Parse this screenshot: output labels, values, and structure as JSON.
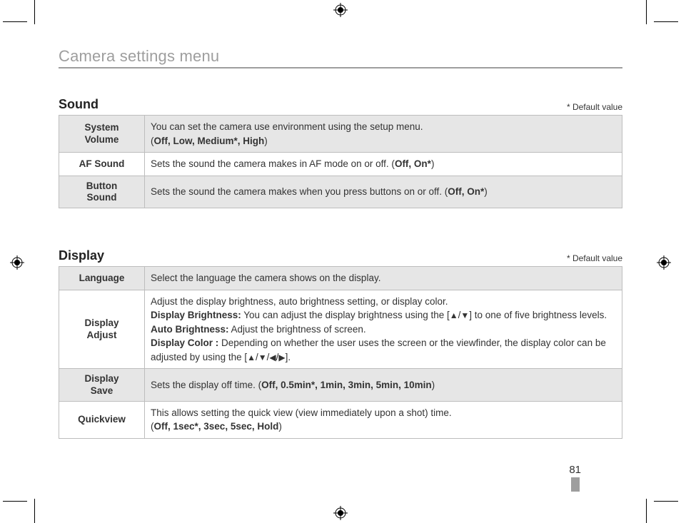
{
  "title": "Camera settings menu",
  "default_note": "* Default value",
  "arrows": {
    "up": "▲",
    "down": "▼",
    "left": "◀",
    "right": "▶",
    "slash": "/"
  },
  "sound": {
    "heading": "Sound",
    "rows": [
      {
        "label_line1": "System",
        "label_line2": "Volume",
        "desc": "You can set the camera use environment using the setup menu.",
        "opts_prefix": "(",
        "opts": "Off, Low, Medium*, High",
        "opts_suffix": ")"
      },
      {
        "label": "AF Sound",
        "desc": "Sets the sound the camera makes in AF mode on or off. (",
        "opts": "Off, On*",
        "opts_suffix": ")"
      },
      {
        "label_line1": "Button",
        "label_line2": "Sound",
        "desc": "Sets the sound the camera makes when you press buttons on or off. (",
        "opts": "Off, On*",
        "opts_suffix": ")"
      }
    ]
  },
  "display": {
    "heading": "Display",
    "rows": [
      {
        "label": "Language",
        "desc": "Select the language the camera shows on the display."
      },
      {
        "label_line1": "Display",
        "label_line2": "Adjust",
        "intro": "Adjust the display brightness, auto brightness setting, or display color.",
        "db_label": "Display Brightness:",
        "db_text_a": " You can adjust the display brightness using the [",
        "db_text_b": "] to one of five brightness levels.",
        "ab_label": "Auto Brightness:",
        "ab_text": " Adjust the brightness of screen.",
        "dc_label": "Display Color :",
        "dc_text_a": " Depending on whether the user uses the screen or the viewfinder, the display color can be adjusted by using the [",
        "dc_text_b": "]."
      },
      {
        "label_line1": "Display",
        "label_line2": "Save",
        "desc": "Sets the display off time. (",
        "opts": "Off, 0.5min*, 1min, 3min, 5min, 10min",
        "opts_suffix": ")"
      },
      {
        "label": "Quickview",
        "desc": "This allows setting the quick view (view immediately upon a shot) time.",
        "opts_prefix": "(",
        "opts": "Off, 1sec*, 3sec, 5sec, Hold",
        "opts_suffix": ")"
      }
    ]
  },
  "page_number": "81"
}
